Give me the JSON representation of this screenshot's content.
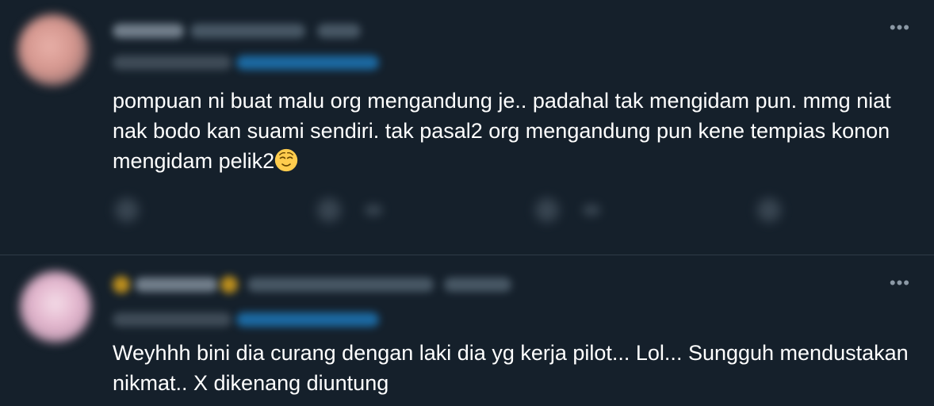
{
  "tweets": [
    {
      "text": "pompuan ni buat malu org mengandung je.. padahal tak mengidam pun. mmg niat nak bodo kan suami sendiri. tak pasal2 org mengandung pun kene tempias konon mengidam pelik2",
      "emoji": "relieved-face",
      "more_label": "•••"
    },
    {
      "text": "Weyhhh bini dia curang dengan laki dia yg kerja pilot... Lol... Sungguh mendustakan nikmat.. X dikenang diuntung",
      "more_label": "•••"
    }
  ],
  "colors": {
    "background": "#15202b",
    "text": "#ffffff",
    "muted": "#8b98a5",
    "link": "#1d9bf0",
    "divider": "#2f3b47"
  }
}
